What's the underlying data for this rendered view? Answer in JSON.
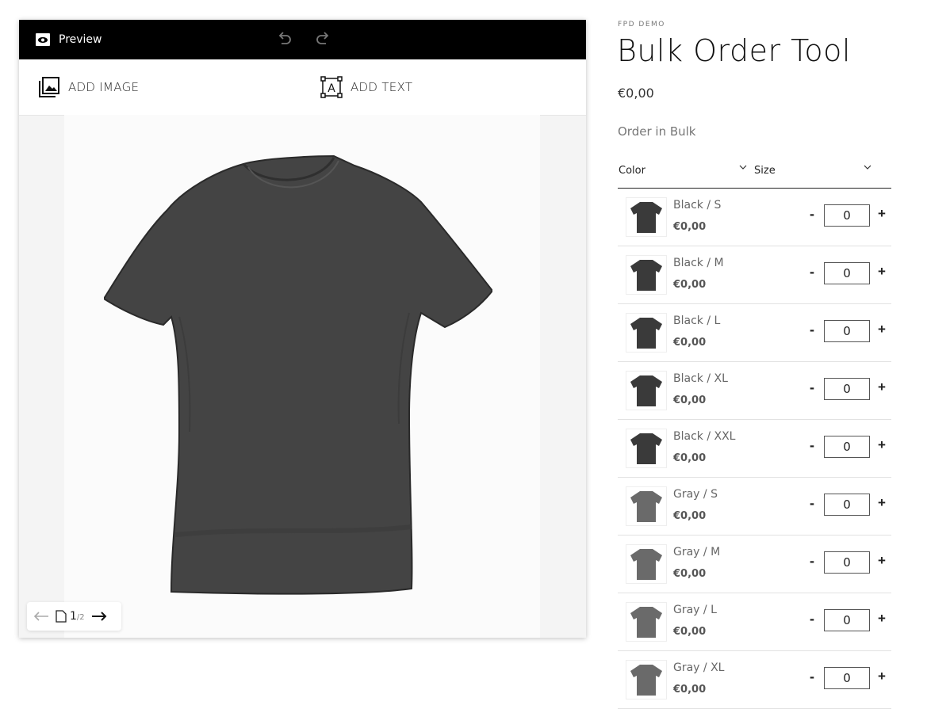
{
  "toolbar": {
    "preview_label": "Preview"
  },
  "actions": {
    "add_image": "ADD IMAGE",
    "add_text": "ADD TEXT"
  },
  "pager": {
    "current": "1",
    "total": "/2"
  },
  "product": {
    "vendor": "FPD DEMO",
    "title": "Bulk Order Tool",
    "price": "€0,00",
    "bulk_label": "Order in Bulk"
  },
  "bulk": {
    "columns": [
      "Color",
      "Size"
    ],
    "rows": [
      {
        "name": "Black / S",
        "price": "€0,00",
        "qty": "0",
        "color": "#3a3a3a"
      },
      {
        "name": "Black / M",
        "price": "€0,00",
        "qty": "0",
        "color": "#3a3a3a"
      },
      {
        "name": "Black / L",
        "price": "€0,00",
        "qty": "0",
        "color": "#3a3a3a"
      },
      {
        "name": "Black / XL",
        "price": "€0,00",
        "qty": "0",
        "color": "#3a3a3a"
      },
      {
        "name": "Black / XXL",
        "price": "€0,00",
        "qty": "0",
        "color": "#3a3a3a"
      },
      {
        "name": "Gray / S",
        "price": "€0,00",
        "qty": "0",
        "color": "#6a6a6a"
      },
      {
        "name": "Gray / M",
        "price": "€0,00",
        "qty": "0",
        "color": "#6a6a6a"
      },
      {
        "name": "Gray / L",
        "price": "€0,00",
        "qty": "0",
        "color": "#6a6a6a"
      },
      {
        "name": "Gray / XL",
        "price": "€0,00",
        "qty": "0",
        "color": "#6a6a6a"
      }
    ]
  },
  "colors": {
    "topbar": "#000000",
    "shirt": "#444444"
  }
}
